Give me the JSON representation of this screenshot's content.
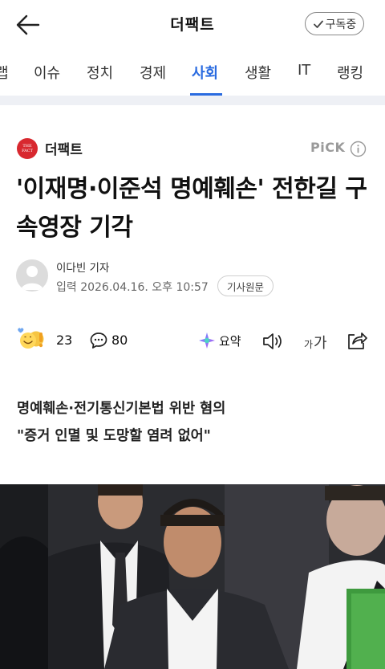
{
  "header": {
    "title": "더팩트",
    "subscribe_label": "구독중"
  },
  "nav_tabs": [
    {
      "label": "랩"
    },
    {
      "label": "이슈"
    },
    {
      "label": "정치"
    },
    {
      "label": "경제"
    },
    {
      "label": "사회"
    },
    {
      "label": "생활"
    },
    {
      "label": "IT"
    },
    {
      "label": "랭킹"
    }
  ],
  "active_tab": "사회",
  "publisher": {
    "name": "더팩트",
    "logo_text": "THE FACT",
    "pick_label": "PiCK"
  },
  "article": {
    "headline": "'이재명·이준석 명예훼손' 전한길 구속영장 기각",
    "reporter": "이다빈 기자",
    "datetime": "입력 2026.04.16. 오후 10:57",
    "original_button": "기사원문",
    "reaction_count": "23",
    "comment_count": "80",
    "summary_label": "요약",
    "font_small": "가",
    "font_big": "가",
    "subheadline_lines": [
      "명예훼손·전기통신기본법 위반 혐의",
      "\"증거 인멸 및 도망할 염려 없어\""
    ]
  },
  "colors": {
    "accent": "#2a6be0",
    "brand_red": "#d8282f",
    "band": "#eef0f5"
  }
}
